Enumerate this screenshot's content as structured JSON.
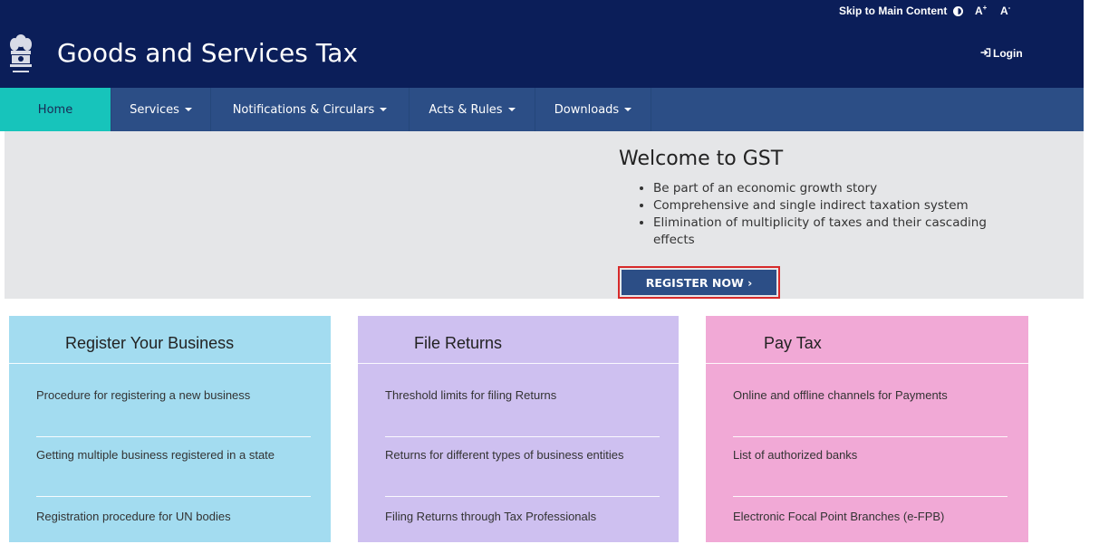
{
  "topbar": {
    "skip_label": "Skip to Main Content",
    "font_increase": "A",
    "font_increase_sup": "+",
    "font_decrease": "A",
    "font_decrease_sup": "-"
  },
  "header": {
    "title": "Goods and Services Tax",
    "login_label": "Login"
  },
  "nav": {
    "items": [
      {
        "label": "Home",
        "dropdown": false,
        "active": true
      },
      {
        "label": "Services",
        "dropdown": true
      },
      {
        "label": "Notifications & Circulars",
        "dropdown": true
      },
      {
        "label": "Acts & Rules",
        "dropdown": true
      },
      {
        "label": "Downloads",
        "dropdown": true
      }
    ]
  },
  "hero": {
    "title": "Welcome to GST",
    "bullets": [
      "Be part of an economic growth story",
      "Comprehensive and single indirect taxation system",
      "Elimination of multiplicity of taxes and their cascading effects"
    ],
    "register_label": "REGISTER NOW ›"
  },
  "cards": [
    {
      "title": "Register Your Business",
      "color": "#a3dcf0",
      "links": [
        "Procedure for registering a new business",
        "Getting multiple business registered in a state",
        "Registration procedure for UN bodies"
      ]
    },
    {
      "title": "File Returns",
      "color": "#cec0f0",
      "links": [
        "Threshold limits for filing Returns",
        "Returns for different types of business entities",
        "Filing Returns through Tax Professionals"
      ]
    },
    {
      "title": "Pay Tax",
      "color": "#f1a9d6",
      "links": [
        "Online and offline channels for Payments",
        "List of authorized banks",
        "Electronic Focal Point Branches (e-FPB)"
      ]
    }
  ],
  "colors": {
    "header_bg": "#0b1e59",
    "nav_bg": "#2c4e86",
    "nav_active": "#17c4bb",
    "hero_bg": "#e5e6e8",
    "highlight_border": "#d72a2a"
  }
}
